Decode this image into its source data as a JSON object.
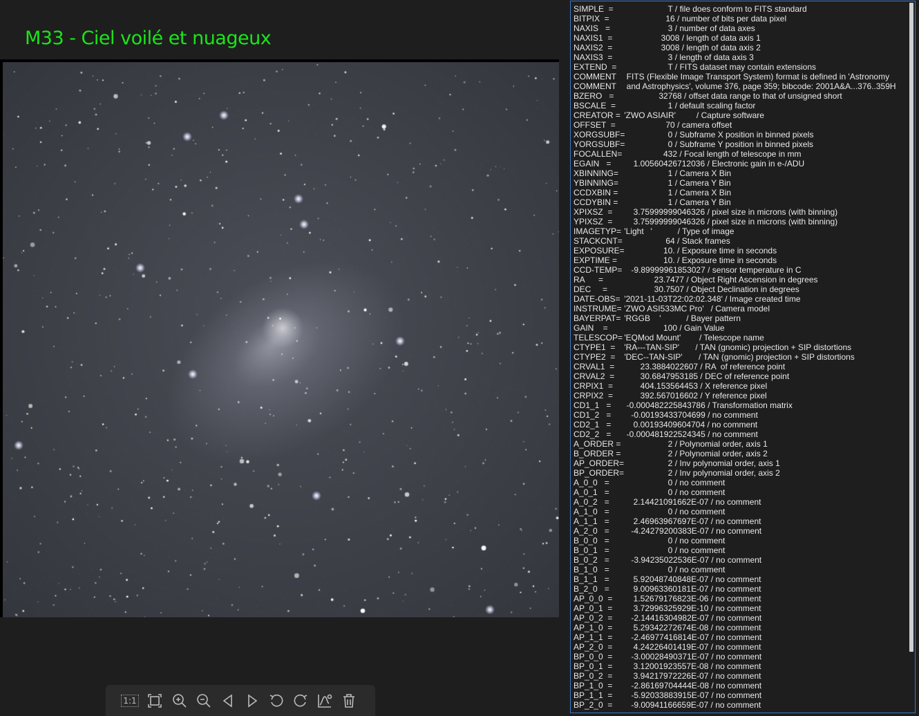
{
  "title": "M33 - Ciel voilé et nuageux",
  "image": {
    "alt": "M33 Triangulum galaxy star field"
  },
  "toolbar": {
    "items": [
      {
        "name": "actual-size",
        "glyph": "1:1"
      },
      {
        "name": "fit-window"
      },
      {
        "name": "zoom-in"
      },
      {
        "name": "zoom-out"
      },
      {
        "name": "previous"
      },
      {
        "name": "next"
      },
      {
        "name": "rotate-left"
      },
      {
        "name": "rotate-right"
      },
      {
        "name": "histogram"
      },
      {
        "name": "delete"
      }
    ]
  },
  "fits_header": [
    {
      "key": "SIMPLE  =",
      "rest": "                    T / file does conform to FITS standard"
    },
    {
      "key": "BITPIX  =",
      "rest": "                   16 / number of bits per data pixel"
    },
    {
      "key": "NAXIS   =",
      "rest": "                    3 / number of data axes"
    },
    {
      "key": "NAXIS1  =",
      "rest": "                 3008 / length of data axis 1"
    },
    {
      "key": "NAXIS2  =",
      "rest": "                 3008 / length of data axis 2"
    },
    {
      "key": "NAXIS3  =",
      "rest": "                    3 / length of data axis 3"
    },
    {
      "key": "EXTEND  =",
      "rest": "                    T / FITS dataset may contain extensions"
    },
    {
      "key": "COMMENT",
      "rest": "  FITS (Flexible Image Transport System) format is defined in 'Astronomy"
    },
    {
      "key": "COMMENT",
      "rest": "  and Astrophysics', volume 376, page 359; bibcode: 2001A&A...376..359H"
    },
    {
      "key": "BZERO   =",
      "rest": "                32768 / offset data range to that of unsigned short"
    },
    {
      "key": "BSCALE  =",
      "rest": "                    1 / default scaling factor"
    },
    {
      "key": "CREATOR =",
      "rest": " 'ZWO ASIAIR'         / Capture software"
    },
    {
      "key": "OFFSET  =",
      "rest": "                   70 / camera offset"
    },
    {
      "key": "XORGSUBF=",
      "rest": "                    0 / Subframe X position in binned pixels"
    },
    {
      "key": "YORGSUBF=",
      "rest": "                    0 / Subframe Y position in binned pixels"
    },
    {
      "key": "FOCALLEN=",
      "rest": "                  432 / Focal length of telescope in mm"
    },
    {
      "key": "EGAIN   =",
      "rest": "     1.00560426712036 / Electronic gain in e-/ADU"
    },
    {
      "key": "XBINNING=",
      "rest": "                    1 / Camera X Bin"
    },
    {
      "key": "YBINNING=",
      "rest": "                    1 / Camera Y Bin"
    },
    {
      "key": "CCDXBIN =",
      "rest": "                    1 / Camera X Bin"
    },
    {
      "key": "CCDYBIN =",
      "rest": "                    1 / Camera Y Bin"
    },
    {
      "key": "XPIXSZ  =",
      "rest": "     3.75999999046326 / pixel size in microns (with binning)"
    },
    {
      "key": "YPIXSZ  =",
      "rest": "     3.75999999046326 / pixel size in microns (with binning)"
    },
    {
      "key": "IMAGETYP=",
      "rest": " 'Light   '           / Type of image"
    },
    {
      "key": "STACKCNT=",
      "rest": "                   64 / Stack frames"
    },
    {
      "key": "EXPOSURE=",
      "rest": "                  10. / Exposure time in seconds"
    },
    {
      "key": "EXPTIME =",
      "rest": "                  10. / Exposure time in seconds"
    },
    {
      "key": "CCD-TEMP=",
      "rest": "    -9.89999961853027 / sensor temperature in C"
    },
    {
      "key": "RA      =",
      "rest": "              23.7477 / Object Right Ascension in degrees"
    },
    {
      "key": "DEC     =",
      "rest": "              30.7507 / Object Declination in degrees"
    },
    {
      "key": "DATE-OBS=",
      "rest": " '2021-11-03T22:02:02.348' / Image created time"
    },
    {
      "key": "INSTRUME=",
      "rest": " 'ZWO ASI533MC Pro'   / Camera model"
    },
    {
      "key": "BAYERPAT=",
      "rest": " 'RGGB    '           / Bayer pattern"
    },
    {
      "key": "GAIN    =",
      "rest": "                  100 / Gain Value"
    },
    {
      "key": "TELESCOP=",
      "rest": " 'EQMod Mount'        / Telescope name"
    },
    {
      "key": "CTYPE1  =",
      "rest": " 'RA---TAN-SIP'       / TAN (gnomic) projection + SIP distortions"
    },
    {
      "key": "CTYPE2  =",
      "rest": " 'DEC--TAN-SIP'       / TAN (gnomic) projection + SIP distortions"
    },
    {
      "key": "CRVAL1  =",
      "rest": "        23.3884022607 / RA  of reference point"
    },
    {
      "key": "CRVAL2  =",
      "rest": "        30.6847953185 / DEC of reference point"
    },
    {
      "key": "CRPIX1  =",
      "rest": "        404.153564453 / X reference pixel"
    },
    {
      "key": "CRPIX2  =",
      "rest": "        392.567016602 / Y reference pixel"
    },
    {
      "key": "CD1_1   =",
      "rest": "  -0.000482225843786 / Transformation matrix"
    },
    {
      "key": "CD1_2   =",
      "rest": "    -0.00193433704699 / no comment"
    },
    {
      "key": "CD2_1   =",
      "rest": "     0.00193409604704 / no comment"
    },
    {
      "key": "CD2_2   =",
      "rest": "  -0.000481922524345 / no comment"
    },
    {
      "key": "A_ORDER =",
      "rest": "                    2 / Polynomial order, axis 1"
    },
    {
      "key": "B_ORDER =",
      "rest": "                    2 / Polynomial order, axis 2"
    },
    {
      "key": "AP_ORDER=",
      "rest": "                    2 / Inv polynomial order, axis 1"
    },
    {
      "key": "BP_ORDER=",
      "rest": "                    2 / Inv polynomial order, axis 2"
    },
    {
      "key": "A_0_0   =",
      "rest": "                    0 / no comment"
    },
    {
      "key": "A_0_1   =",
      "rest": "                    0 / no comment"
    },
    {
      "key": "A_0_2   =",
      "rest": "     2.14421091662E-07 / no comment"
    },
    {
      "key": "A_1_0   =",
      "rest": "                    0 / no comment"
    },
    {
      "key": "A_1_1   =",
      "rest": "     2.46963967697E-07 / no comment"
    },
    {
      "key": "A_2_0   =",
      "rest": "    -4.24279200383E-07 / no comment"
    },
    {
      "key": "B_0_0   =",
      "rest": "                    0 / no comment"
    },
    {
      "key": "B_0_1   =",
      "rest": "                    0 / no comment"
    },
    {
      "key": "B_0_2   =",
      "rest": "    -3.94235022536E-07 / no comment"
    },
    {
      "key": "B_1_0   =",
      "rest": "                    0 / no comment"
    },
    {
      "key": "B_1_1   =",
      "rest": "     5.92048740848E-07 / no comment"
    },
    {
      "key": "B_2_0   =",
      "rest": "     9.00963360181E-07 / no comment"
    },
    {
      "key": "AP_0_0  =",
      "rest": "     1.52679176823E-06 / no comment"
    },
    {
      "key": "AP_0_1  =",
      "rest": "     3.72996325929E-10 / no comment"
    },
    {
      "key": "AP_0_2  =",
      "rest": "    -2.14416304982E-07 / no comment"
    },
    {
      "key": "AP_1_0  =",
      "rest": "     5.29342272674E-08 / no comment"
    },
    {
      "key": "AP_1_1  =",
      "rest": "    -2.46977416814E-07 / no comment"
    },
    {
      "key": "AP_2_0  =",
      "rest": "     4.24226401419E-07 / no comment"
    },
    {
      "key": "BP_0_0  =",
      "rest": "    -3.00028490371E-07 / no comment"
    },
    {
      "key": "BP_0_1  =",
      "rest": "     3.12001923557E-08 / no comment"
    },
    {
      "key": "BP_0_2  =",
      "rest": "     3.94217972226E-07 / no comment"
    },
    {
      "key": "BP_1_0  =",
      "rest": "    -2.86169704444E-08 / no comment"
    },
    {
      "key": "BP_1_1  =",
      "rest": "    -5.92033883915E-07 / no comment"
    },
    {
      "key": "BP_2_0  =",
      "rest": "    -9.00941166659E-07 / no comment"
    }
  ]
}
